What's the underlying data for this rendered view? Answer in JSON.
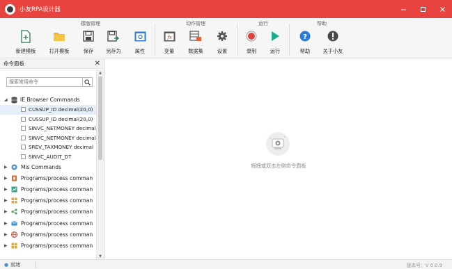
{
  "window": {
    "title": "小友RPA设计器",
    "controls": [
      "minimize-icon",
      "maximize-icon",
      "close-icon"
    ],
    "accent": "#e8433f"
  },
  "ribbon": {
    "groups": [
      {
        "title": "模版管理",
        "tools": [
          {
            "label": "新建模板",
            "icon": "new-file-icon"
          },
          {
            "label": "打开模板",
            "icon": "folder-icon"
          },
          {
            "label": "保存",
            "icon": "save-icon"
          },
          {
            "label": "另存为",
            "icon": "save-as-icon"
          },
          {
            "label": "属性",
            "icon": "properties-icon"
          }
        ]
      },
      {
        "title": "动作管理",
        "tools": [
          {
            "label": "变量",
            "icon": "variable-icon"
          },
          {
            "label": "数据集",
            "icon": "dataset-icon"
          },
          {
            "label": "设置",
            "icon": "gear-icon"
          }
        ]
      },
      {
        "title": "运行",
        "tools": [
          {
            "label": "录制",
            "icon": "record-icon"
          },
          {
            "label": "运行",
            "icon": "play-icon"
          }
        ]
      },
      {
        "title": "帮助",
        "tools": [
          {
            "label": "帮助",
            "icon": "help-icon"
          },
          {
            "label": "关于小友",
            "icon": "about-icon"
          }
        ]
      }
    ]
  },
  "panel": {
    "title": "命令面板",
    "search_placeholder": "搜索常用命令",
    "root": {
      "label": "IE Browser Commands",
      "items": [
        "CUSSUP_ID decimal(20,0)",
        "CUSSUP_ID decimal(20,0)",
        "SINVC_NETMONEY decimal",
        "SINVC_NETMONEY decimal",
        "SREV_TAXMONEY decimal",
        "SINVC_AUDIT_DT"
      ]
    },
    "groups": [
      {
        "label": "Mis Commands",
        "icon": "mis-icon",
        "color": "#4a90d9"
      },
      {
        "label": "Programs/process comman",
        "icon": "office-icon",
        "color": "#e8632c"
      },
      {
        "label": "Programs/process comman",
        "icon": "chart-app-icon",
        "color": "#2ca58d"
      },
      {
        "label": "Programs/process comman",
        "icon": "grid-app-icon",
        "color": "#f2a22b"
      },
      {
        "label": "Programs/process comman",
        "icon": "share-icon",
        "color": "#3fa34d"
      },
      {
        "label": "Programs/process comman",
        "icon": "mail-icon",
        "color": "#3a8fd8"
      },
      {
        "label": "Programs/process comman",
        "icon": "globe-icon",
        "color": "#e0452d"
      },
      {
        "label": "Programs/process comman",
        "icon": "grid-app-icon",
        "color": "#f2a22b"
      }
    ]
  },
  "canvas": {
    "empty_text": "拖拽或双击左侧命令面板"
  },
  "status": {
    "text": "就绪",
    "version": "版本号：V 0.0.9"
  }
}
